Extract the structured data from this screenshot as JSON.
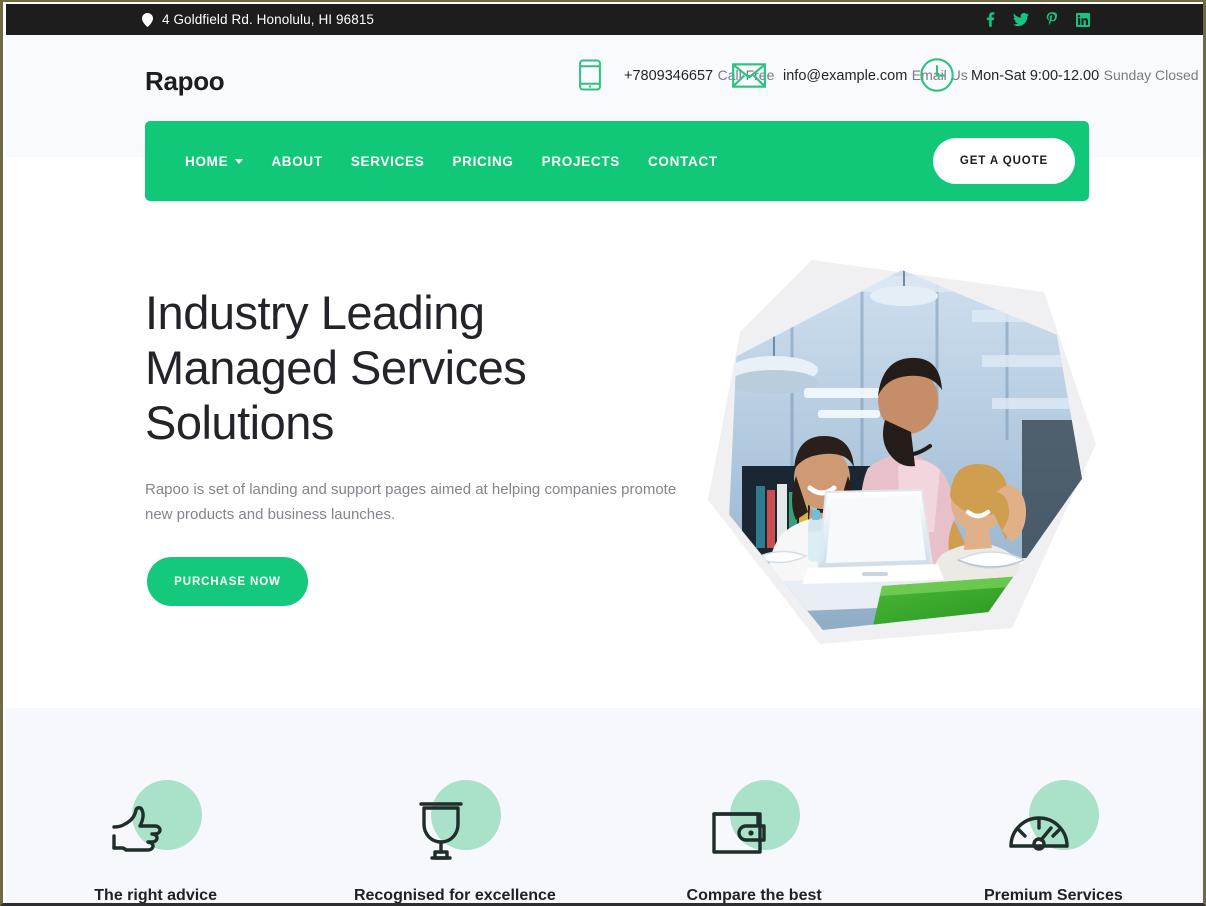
{
  "topbar": {
    "address": "4 Goldfield Rd. Honolulu, HI 96815",
    "pin_icon": "location-pin-icon",
    "social": [
      {
        "name": "facebook-icon",
        "label": "f"
      },
      {
        "name": "twitter-icon",
        "label": "t"
      },
      {
        "name": "pinterest-icon",
        "label": "p"
      },
      {
        "name": "linkedin-icon",
        "label": "in"
      }
    ],
    "background": "#1d1d1d",
    "social_color": "#13c57f"
  },
  "header": {
    "logo": "Rapoo",
    "contacts": [
      {
        "icon": "mobile-phone-icon",
        "main": "+7809346657",
        "sub": "Call Free"
      },
      {
        "icon": "envelope-icon",
        "main": "info@example.com",
        "sub": "Email Us"
      },
      {
        "icon": "clock-icon",
        "main": "Mon-Sat 9:00-12.00",
        "sub": "Sunday Closed"
      }
    ],
    "background": "#f9fafd"
  },
  "nav": {
    "accent": "#10c878",
    "items": [
      {
        "label": "HOME",
        "has_caret": true
      },
      {
        "label": "ABOUT",
        "has_caret": false
      },
      {
        "label": "SERVICES",
        "has_caret": false
      },
      {
        "label": "PRICING",
        "has_caret": false
      },
      {
        "label": "PROJECTS",
        "has_caret": false
      },
      {
        "label": "CONTACT",
        "has_caret": false
      }
    ],
    "quote_button": "GET A QUOTE"
  },
  "hero": {
    "title_line1": "Industry Leading",
    "title_line2": "Managed Services",
    "title_line3": "Solutions",
    "subtitle": "Rapoo is set of landing and support pages aimed at helping companies promote new products and business launches.",
    "cta": "PURCHASE NOW",
    "cta_color": "#14c97c",
    "image_alt": "three people working together at a laptop in an office library"
  },
  "features": {
    "background": "#f7f8fd",
    "blob_color": "#a9e2c9",
    "items": [
      {
        "icon": "thumbs-up-icon",
        "label": "The right advice"
      },
      {
        "icon": "trophy-icon",
        "label": "Recognised for excellence"
      },
      {
        "icon": "wallet-icon",
        "label": "Compare the best"
      },
      {
        "icon": "speedometer-icon",
        "label": "Premium Services"
      }
    ]
  }
}
